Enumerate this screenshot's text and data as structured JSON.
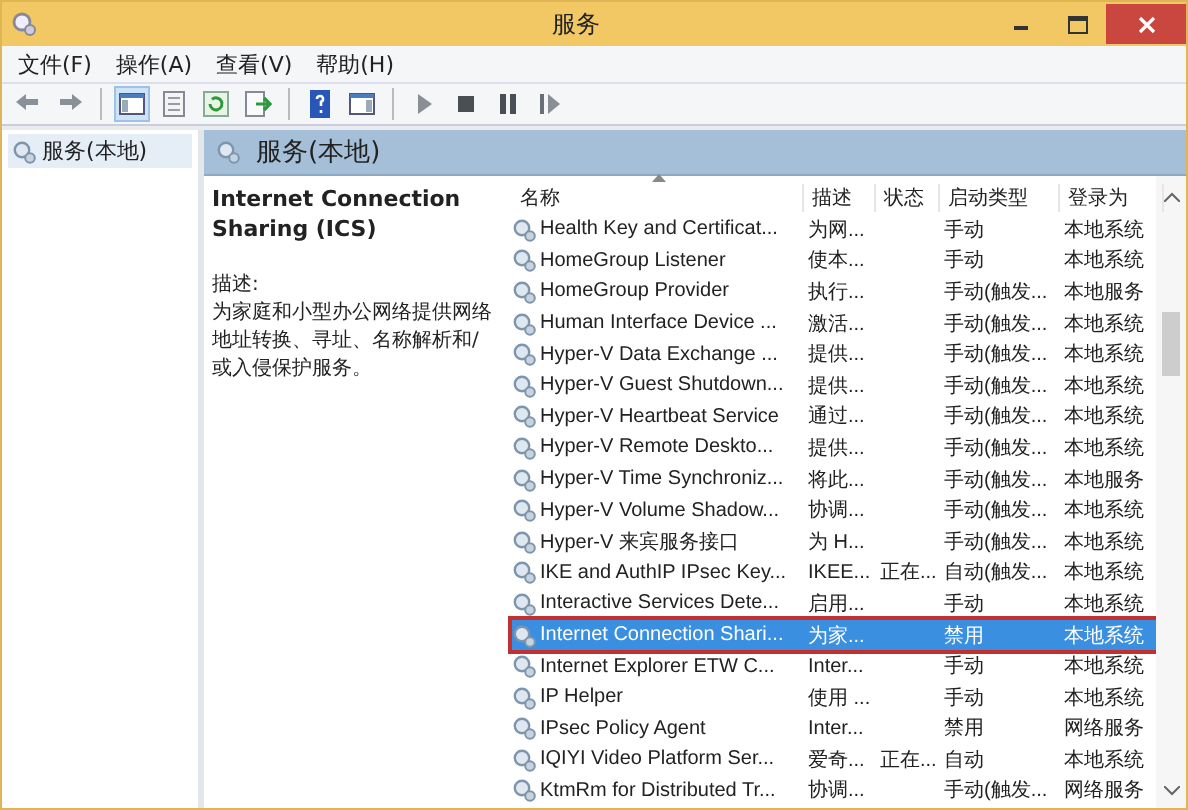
{
  "window": {
    "title": "服务"
  },
  "menu": [
    "文件(F)",
    "操作(A)",
    "查看(V)",
    "帮助(H)"
  ],
  "tree": {
    "items": [
      {
        "label": "服务(本地)",
        "selected": true
      }
    ]
  },
  "panel": {
    "title": "服务(本地)"
  },
  "detail": {
    "title": "Internet Connection Sharing (ICS)",
    "description_label": "描述:",
    "description": "为家庭和小型办公网络提供网络地址转换、寻址、名称解析和/或入侵保护服务。"
  },
  "table": {
    "columns": [
      "名称",
      "描述",
      "状态",
      "启动类型",
      "登录为"
    ],
    "rows": [
      {
        "cells": [
          "Health Key and Certificat...",
          "为网...",
          "",
          "手动",
          "本地系统"
        ],
        "selected": false
      },
      {
        "cells": [
          "HomeGroup Listener",
          "使本...",
          "",
          "手动",
          "本地系统"
        ],
        "selected": false
      },
      {
        "cells": [
          "HomeGroup Provider",
          "执行...",
          "",
          "手动(触发...",
          "本地服务"
        ],
        "selected": false
      },
      {
        "cells": [
          "Human Interface Device ...",
          "激活...",
          "",
          "手动(触发...",
          "本地系统"
        ],
        "selected": false
      },
      {
        "cells": [
          "Hyper-V Data Exchange ...",
          "提供...",
          "",
          "手动(触发...",
          "本地系统"
        ],
        "selected": false
      },
      {
        "cells": [
          "Hyper-V Guest Shutdown...",
          "提供...",
          "",
          "手动(触发...",
          "本地系统"
        ],
        "selected": false
      },
      {
        "cells": [
          "Hyper-V Heartbeat Service",
          "通过...",
          "",
          "手动(触发...",
          "本地系统"
        ],
        "selected": false
      },
      {
        "cells": [
          "Hyper-V Remote Deskto...",
          "提供...",
          "",
          "手动(触发...",
          "本地系统"
        ],
        "selected": false
      },
      {
        "cells": [
          "Hyper-V Time Synchroniz...",
          "将此...",
          "",
          "手动(触发...",
          "本地服务"
        ],
        "selected": false
      },
      {
        "cells": [
          "Hyper-V Volume Shadow...",
          "协调...",
          "",
          "手动(触发...",
          "本地系统"
        ],
        "selected": false
      },
      {
        "cells": [
          "Hyper-V 来宾服务接口",
          "为 H...",
          "",
          "手动(触发...",
          "本地系统"
        ],
        "selected": false
      },
      {
        "cells": [
          "IKE and AuthIP IPsec Key...",
          "IKEE...",
          "正在...",
          "自动(触发...",
          "本地系统"
        ],
        "selected": false
      },
      {
        "cells": [
          "Interactive Services Dete...",
          "启用...",
          "",
          "手动",
          "本地系统"
        ],
        "selected": false
      },
      {
        "cells": [
          "Internet Connection Shari...",
          "为家...",
          "",
          "禁用",
          "本地系统"
        ],
        "selected": true
      },
      {
        "cells": [
          "Internet Explorer ETW C...",
          "Inter...",
          "",
          "手动",
          "本地系统"
        ],
        "selected": false
      },
      {
        "cells": [
          "IP Helper",
          "使用 ...",
          "",
          "手动",
          "本地系统"
        ],
        "selected": false
      },
      {
        "cells": [
          "IPsec Policy Agent",
          "Inter...",
          "",
          "禁用",
          "网络服务"
        ],
        "selected": false
      },
      {
        "cells": [
          "IQIYI Video Platform Ser...",
          "爱奇...",
          "正在...",
          "自动",
          "本地系统"
        ],
        "selected": false
      },
      {
        "cells": [
          "KtmRm for Distributed Tr...",
          "协调...",
          "",
          "手动(触发...",
          "网络服务"
        ],
        "selected": false
      }
    ]
  }
}
